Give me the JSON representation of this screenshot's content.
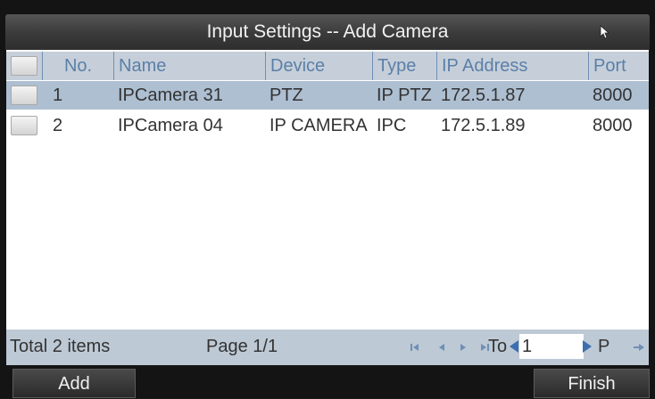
{
  "window": {
    "title": "Input Settings -- Add Camera"
  },
  "table": {
    "columns": [
      "No.",
      "Name",
      "Device",
      "Type",
      "IP Address",
      "Port"
    ],
    "rows": [
      {
        "no": "1",
        "name": "IPCamera 31",
        "device": "PTZ",
        "type": "IP PTZ",
        "ip": "172.5.1.87",
        "port": "8000",
        "selected": true
      },
      {
        "no": "2",
        "name": "IPCamera 04",
        "device": "IP CAMERA",
        "type": "IPC",
        "ip": "172.5.1.89",
        "port": "8000",
        "selected": false
      }
    ]
  },
  "status": {
    "total": "Total 2 items",
    "page": "Page 1/1",
    "to_label": "To",
    "page_value": "1",
    "page_suffix": "P"
  },
  "buttons": {
    "add": "Add",
    "finish": "Finish"
  },
  "colors": {
    "header_bg": "#c6cfd9",
    "header_text": "#5b7fa8",
    "selected_row": "#aebfd2",
    "status_bg": "#bdc9d5"
  }
}
